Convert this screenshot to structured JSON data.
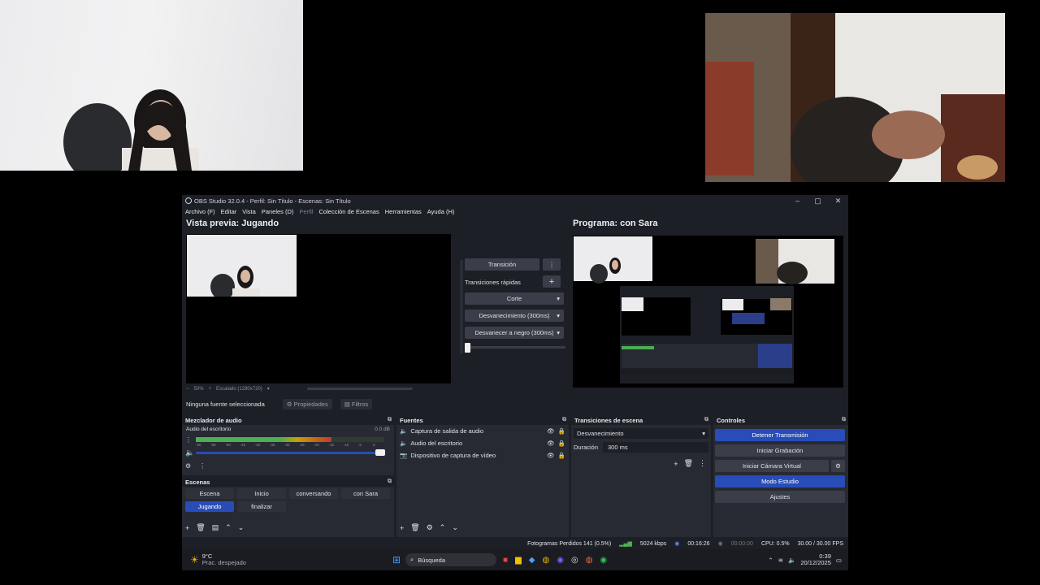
{
  "window": {
    "title": "OBS Studio 32.0.4 - Perfil: Sin Título - Escenas: Sin Título",
    "menu": [
      "Archivo (F)",
      "Editar",
      "Vista",
      "Paneles (D)",
      "Perfil",
      "Colección de Escenas",
      "Herramientas",
      "Ayuda (H)"
    ]
  },
  "preview": {
    "title": "Vista previa: Jugando",
    "zoom": "50%",
    "zoom_mode": "Escalado (1280x720)"
  },
  "program": {
    "title": "Programa: con Sara"
  },
  "transition_panel": {
    "transition_label": "Transición",
    "quick_label": "Transiciones rápidas",
    "items": [
      "Corte",
      "Desvanecimiento (300ms)",
      "Desvanecer a negro (300ms)"
    ]
  },
  "source_bar": {
    "none_selected": "Ninguna fuente seleccionada",
    "properties": "Propiedades",
    "filters": "Filtros"
  },
  "mixer": {
    "title": "Mezclador de audio",
    "channel": "Audio del escritorio",
    "db": "0.0 dB",
    "ticks": [
      "-60",
      "-55",
      "-50",
      "-45",
      "-40",
      "-35",
      "-30",
      "-25",
      "-20",
      "-15",
      "-10",
      "-5",
      "0"
    ],
    "level": 0.72
  },
  "scenes": {
    "title": "Escenas",
    "items": [
      "Escena",
      "Inicio",
      "conversando",
      "con Sara",
      "Jugando",
      "finalizar"
    ],
    "active": "Jugando"
  },
  "sources": {
    "title": "Fuentes",
    "items": [
      {
        "label": "Captura de salida de audio",
        "icon": "speaker-icon"
      },
      {
        "label": "Audio del escritorio",
        "icon": "speaker-icon"
      },
      {
        "label": "Dispositivo de captura de vídeo",
        "icon": "camera-icon"
      }
    ]
  },
  "scene_transitions": {
    "title": "Transiciones de escena",
    "selected": "Desvanecimiento",
    "duration_label": "Duración",
    "duration_value": "300 ms"
  },
  "controls": {
    "title": "Controles",
    "stop_stream": "Detener Transmisión",
    "start_recording": "Iniciar Grabación",
    "virtual_camera": "Iniciar Cámara Virtual",
    "studio_mode": "Modo Estudio",
    "settings": "Ajustes"
  },
  "status_bar": {
    "dropped": "Fotogramas Perdidos 141 (0.5%)",
    "bitrate": "5024 kbps",
    "stream_time": "00:16:26",
    "rec_time": "00:00:00",
    "cpu": "CPU: 0.5%",
    "fps": "30.00 / 30.00 FPS"
  },
  "taskbar": {
    "weather_temp": "9°C",
    "weather_desc": "Prac. despejado",
    "search": "Búsqueda",
    "time": "0:39",
    "date": "20/12/2025"
  },
  "colors": {
    "accent_blue": "#284cb8",
    "meter_green": "#4caf50",
    "meter_red": "#c0392b"
  }
}
